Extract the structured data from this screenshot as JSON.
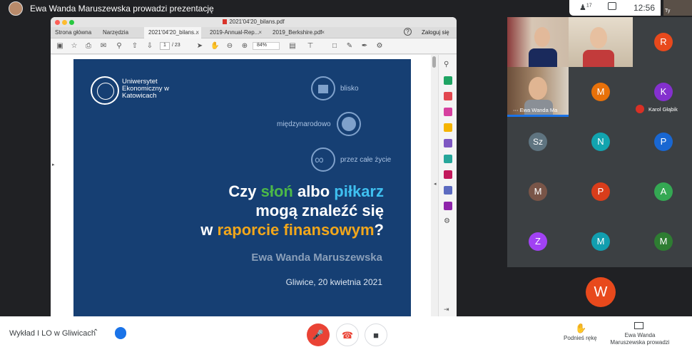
{
  "meet": {
    "presenting_banner": "Ewa Wanda Maruszewska prowadzi prezentację",
    "participants_count": "17",
    "time": "12:56",
    "self_label": "Ty",
    "meeting_name": "Wykład I LO w Gliwicach",
    "raise_hand_label": "Podnieś rękę",
    "presenting_label": "Ewa Wanda Maruszewska prowadzi prezentację"
  },
  "pdf": {
    "doc_title": "2021'04'20_bilans.pdf",
    "nav_home": "Strona główna",
    "nav_tools": "Narzędzia",
    "tabs": [
      {
        "label": "2021'04'20_bilans..."
      },
      {
        "label": "2019-Annual-Rep..."
      },
      {
        "label": "2019_Berkshire.pdf"
      }
    ],
    "help": "?",
    "login": "Zaloguj się",
    "page_current": "1",
    "page_total": "/ 23",
    "zoom": "84%"
  },
  "slide": {
    "university": "Uniwersytet Ekonomiczny w Katowicach",
    "label_close": "blisko",
    "label_international": "międzynarodowo",
    "label_lifelong": "przez całe życie",
    "headline_1a": "Czy ",
    "headline_1b": "słoń",
    "headline_1c": " albo ",
    "headline_1d": "piłkarz",
    "headline_2": "mogą znaleźć się",
    "headline_3a": "w ",
    "headline_3b": "raporcie finansowym",
    "headline_3c": "?",
    "author": "Ewa Wanda Maruszewska",
    "place_date": "Gliwice, 20 kwietnia 2021"
  },
  "participants": {
    "video_label": "Ewa Wanda Ma",
    "muted_name": "Karol Głąbik",
    "tiles": [
      {
        "initial": "R",
        "color": "#e8491c"
      },
      {
        "initial": "M",
        "color": "#e8710a"
      },
      {
        "initial": "K",
        "color": "#8430ce"
      },
      {
        "initial": "Sz",
        "color": "#5f7480"
      },
      {
        "initial": "N",
        "color": "#12a4af"
      },
      {
        "initial": "P",
        "color": "#1967d2"
      },
      {
        "initial": "M",
        "color": "#795548"
      },
      {
        "initial": "P",
        "color": "#d93d1b"
      },
      {
        "initial": "A",
        "color": "#34a853"
      },
      {
        "initial": "Z",
        "color": "#a142f4"
      },
      {
        "initial": "M",
        "color": "#129eaf"
      },
      {
        "initial": "M",
        "color": "#2e7d32"
      }
    ],
    "big_initial": "W"
  }
}
